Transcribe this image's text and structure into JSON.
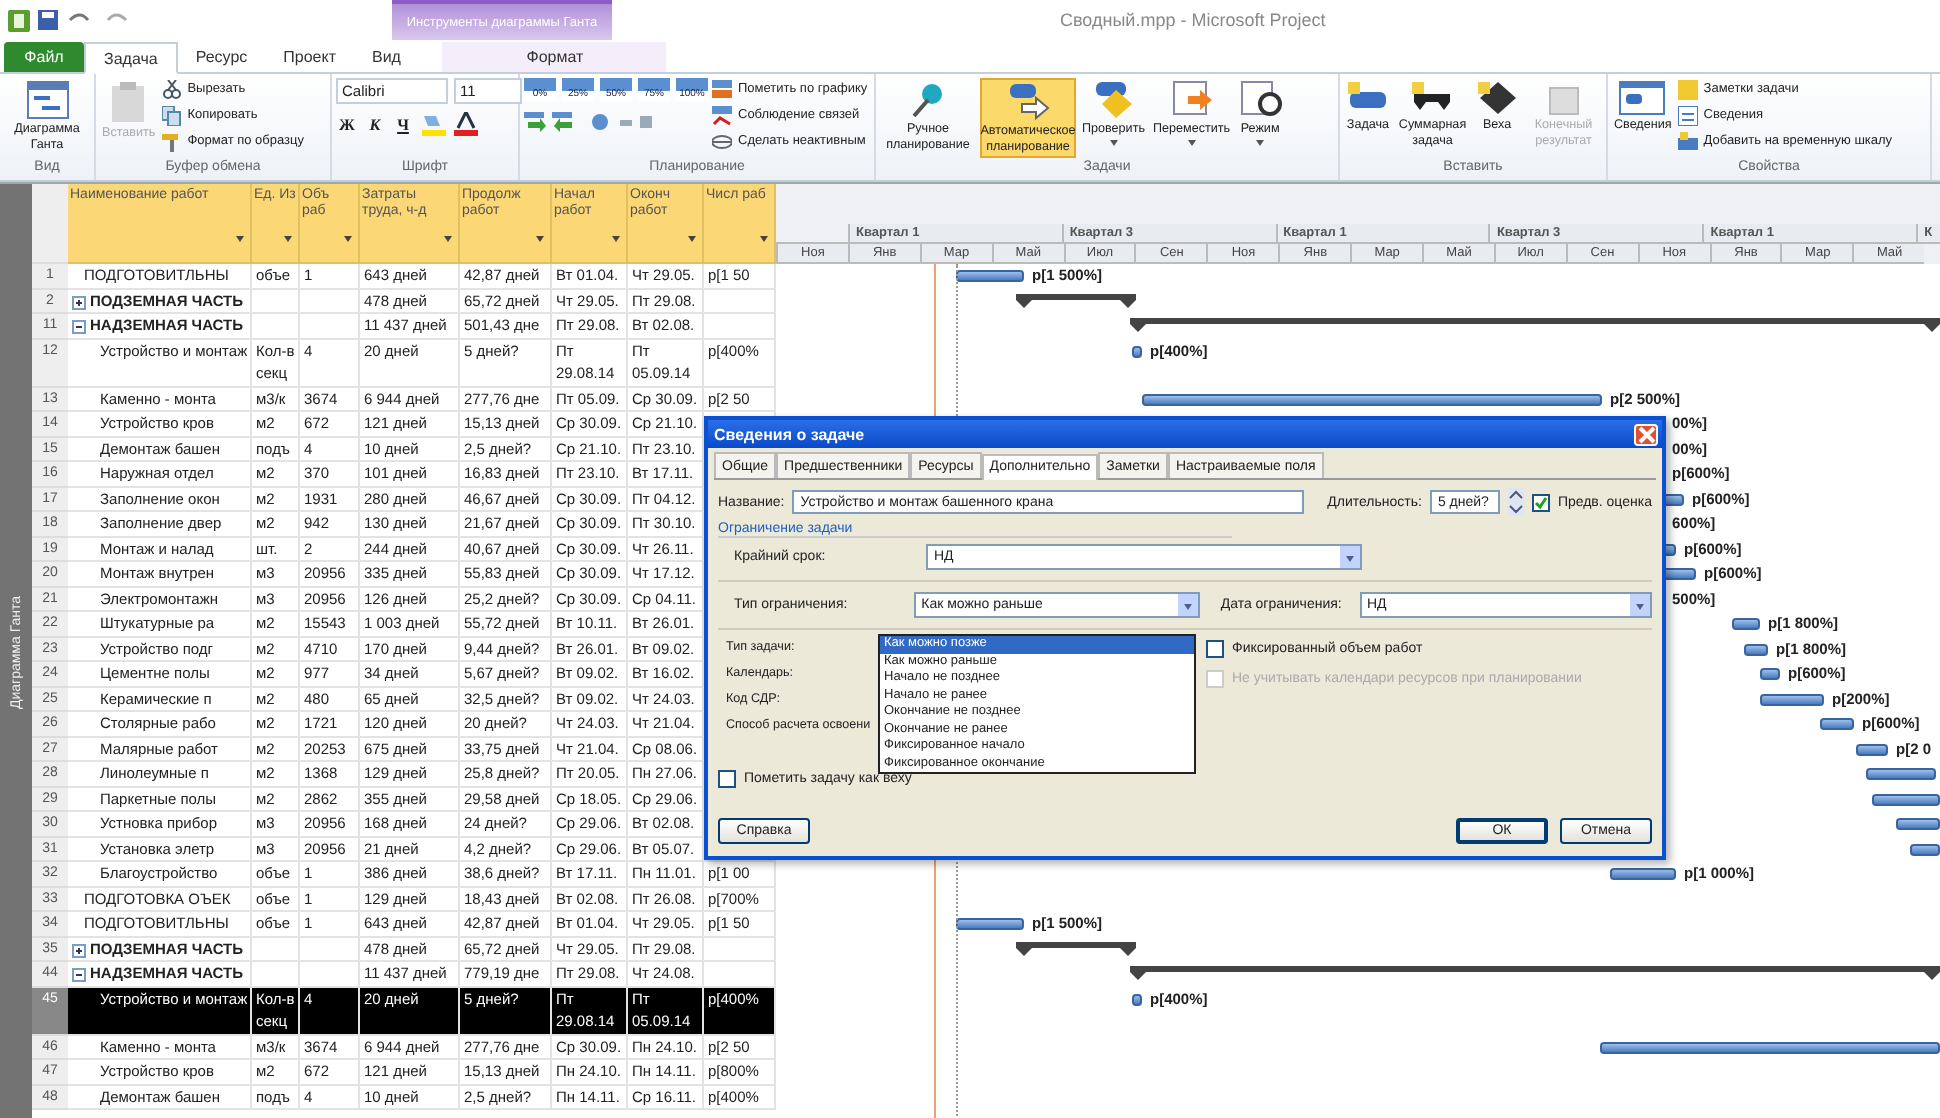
{
  "window": {
    "title": "Сводный.mpp - Microsoft Project",
    "contextual_group": "Инструменты диаграммы Ганта"
  },
  "ribbon_tabs": [
    {
      "label": "Файл",
      "kind": "file",
      "selected": false
    },
    {
      "label": "Задача",
      "kind": "normal",
      "selected": true
    },
    {
      "label": "Ресурс",
      "kind": "normal",
      "selected": false
    },
    {
      "label": "Проект",
      "kind": "normal",
      "selected": false
    },
    {
      "label": "Вид",
      "kind": "normal",
      "selected": false
    },
    {
      "label": "Формат",
      "kind": "contextual",
      "selected": false
    }
  ],
  "ribbon": {
    "view": {
      "label": "Вид",
      "gantt_button": "Диаграмма Ганта"
    },
    "clipboard": {
      "label": "Буфер обмена",
      "paste": {
        "label": "Вставить",
        "disabled": true
      },
      "commands": [
        "Вырезать",
        "Копировать",
        "Формат по образцу"
      ]
    },
    "font": {
      "label": "Шрифт",
      "family": "Calibri",
      "size": "11",
      "styles": [
        "Ж",
        "К",
        "Ч"
      ]
    },
    "schedule": {
      "label": "Планирование",
      "percents": [
        "0%",
        "25%",
        "50%",
        "75%",
        "100%"
      ],
      "commands": [
        "Пометить по графику",
        "Соблюдение связей",
        "Сделать неактивным"
      ]
    },
    "tasks": {
      "label": "Задачи",
      "buttons": [
        {
          "label": "Ручное планирование",
          "selected": false
        },
        {
          "label": "Автоматическое планирование",
          "selected": true
        },
        {
          "label": "Проверить",
          "selected": false
        },
        {
          "label": "Переместить",
          "selected": false
        },
        {
          "label": "Режим",
          "selected": false
        }
      ]
    },
    "insert": {
      "label": "Вставить",
      "buttons": [
        {
          "label": "Задача",
          "disabled": false
        },
        {
          "label": "Суммарная задача",
          "disabled": false
        },
        {
          "label": "Веха",
          "disabled": false
        },
        {
          "label": "Конечный результат",
          "disabled": true
        }
      ]
    },
    "properties": {
      "label": "Свойства",
      "big_button": "Сведения",
      "commands": [
        "Заметки задачи",
        "Сведения",
        "Добавить на временную шкалу"
      ]
    }
  },
  "side_label": "Диаграмма Ганта",
  "table": {
    "columns": [
      "Наименование работ",
      "Ед. Из",
      "Объ раб",
      "Затраты труда, ч-д",
      "Продолж работ",
      "Начал работ",
      "Оконч работ",
      "Числ раб"
    ],
    "rows": [
      {
        "id": "1",
        "name": "ПОДГОТОВИТЛЬНЫ",
        "unit": "объе",
        "volume": "1",
        "labor": "643 дней",
        "duration": "42,87 дней",
        "start": "Вт 01.04.",
        "finish": "Чт 29.05.",
        "resource": "р[1 50",
        "selected": false,
        "bar": {
          "kind": "task",
          "label": "р[1 500%]"
        }
      },
      {
        "id": "2",
        "name": "ПОДЗЕМНАЯ ЧАСТЬ",
        "labor": "478 дней",
        "duration": "65,72 дней",
        "start": "Чт 29.05.",
        "finish": "Пт 29.08.",
        "selected": false,
        "expanded": false,
        "bar": {
          "kind": "summary"
        }
      },
      {
        "id": "11",
        "name": "НАДЗЕМНАЯ ЧАСТЬ",
        "labor": "11 437 дней",
        "duration": "501,43 дне",
        "start": "Пт 29.08.",
        "finish": "Вт 02.08.",
        "selected": false,
        "expanded": true,
        "bar": {
          "kind": "summary"
        },
        "children": [
          {
            "id": "12",
            "name": "Устройство и монтаж",
            "unit": "Кол-в секц",
            "volume": "4",
            "labor": "20 дней",
            "duration": "5 дней?",
            "start": "Пт 29.08.14",
            "finish": "Пт 05.09.14",
            "resource": "р[400%",
            "selected": false,
            "bar": {
              "kind": "task",
              "label": "р[400%]"
            }
          },
          {
            "id": "13",
            "name": "Каменно - монта",
            "unit": "м3/к",
            "volume": "3674",
            "labor": "6 944 дней",
            "duration": "277,76 дне",
            "start": "Пт 05.09.",
            "finish": "Ср 30.09.",
            "resource": "р[2 50",
            "selected": false,
            "bar": {
              "kind": "task",
              "label": "р[2 500%]"
            }
          },
          {
            "id": "14",
            "name": "Устройство кров",
            "unit": "м2",
            "volume": "672",
            "labor": "121 дней",
            "duration": "15,13 дней",
            "start": "Ср 30.09.",
            "finish": "Ср 21.10.",
            "selected": false,
            "bar": {
              "kind": "label",
              "label": "00%]"
            }
          },
          {
            "id": "15",
            "name": "Демонтаж башен",
            "unit": "подъ",
            "volume": "4",
            "labor": "10 дней",
            "duration": "2,5 дней?",
            "start": "Ср 21.10.",
            "finish": "Пт 23.10.",
            "selected": false,
            "bar": {
              "kind": "label",
              "label": "00%]"
            }
          },
          {
            "id": "16",
            "name": "Наружная отдел",
            "unit": "м2",
            "volume": "370",
            "labor": "101 дней",
            "duration": "16,83 дней",
            "start": "Пт 23.10.",
            "finish": "Вт 17.11.",
            "selected": false,
            "bar": {
              "kind": "label",
              "label": "р[600%]"
            }
          },
          {
            "id": "17",
            "name": "Заполнение окон",
            "unit": "м2",
            "volume": "1931",
            "labor": "280 дней",
            "duration": "46,67 дней",
            "start": "Ср 30.09.",
            "finish": "Пт 04.12.",
            "selected": false,
            "bar": {
              "kind": "task",
              "label": "р[600%]"
            }
          },
          {
            "id": "18",
            "name": "Заполнение двер",
            "unit": "м2",
            "volume": "942",
            "labor": "130 дней",
            "duration": "21,67 дней",
            "start": "Ср 30.09.",
            "finish": "Пт 30.10.",
            "selected": false,
            "bar": {
              "kind": "label",
              "label": "600%]"
            }
          },
          {
            "id": "19",
            "name": "Монтаж и налад",
            "unit": "шт.",
            "volume": "2",
            "labor": "244 дней",
            "duration": "40,67 дней",
            "start": "Ср 30.09.",
            "finish": "Чт 26.11.",
            "selected": false,
            "bar": {
              "kind": "task",
              "label": "р[600%]"
            }
          },
          {
            "id": "20",
            "name": "Монтаж внутрен",
            "unit": "м3",
            "volume": "20956",
            "labor": "335 дней",
            "duration": "55,83 дней",
            "start": "Ср 30.09.",
            "finish": "Чт 17.12.",
            "selected": false,
            "bar": {
              "kind": "task",
              "label": "р[600%]"
            }
          },
          {
            "id": "21",
            "name": "Электромонтажн",
            "unit": "м3",
            "volume": "20956",
            "labor": "126 дней",
            "duration": "25,2 дней?",
            "start": "Ср 30.09.",
            "finish": "Ср 04.11.",
            "selected": false,
            "bar": {
              "kind": "label",
              "label": "500%]"
            }
          },
          {
            "id": "22",
            "name": "Штукатурные ра",
            "unit": "м2",
            "volume": "15543",
            "labor": "1 003 дней",
            "duration": "55,72 дней",
            "start": "Вт 10.11.",
            "finish": "Вт 26.01.",
            "selected": false,
            "bar": {
              "kind": "task",
              "label": "р[1 800%]"
            }
          },
          {
            "id": "23",
            "name": "Устройство подг",
            "unit": "м2",
            "volume": "4710",
            "labor": "170 дней",
            "duration": "9,44 дней?",
            "start": "Вт 26.01.",
            "finish": "Вт 09.02.",
            "selected": false,
            "bar": {
              "kind": "task",
              "label": "р[1 800%]"
            }
          },
          {
            "id": "24",
            "name": "Цементне полы",
            "unit": "м2",
            "volume": "977",
            "labor": "34 дней",
            "duration": "5,67 дней?",
            "start": "Вт 09.02.",
            "finish": "Вт 16.02.",
            "selected": false,
            "bar": {
              "kind": "task",
              "label": "р[600%]"
            }
          },
          {
            "id": "25",
            "name": "Керамические п",
            "unit": "м2",
            "volume": "480",
            "labor": "65 дней",
            "duration": "32,5 дней?",
            "start": "Вт 09.02.",
            "finish": "Чт 24.03.",
            "selected": false,
            "bar": {
              "kind": "task",
              "label": "р[200%]"
            }
          },
          {
            "id": "26",
            "name": "Столярные рабо",
            "unit": "м2",
            "volume": "1721",
            "labor": "120 дней",
            "duration": "20 дней?",
            "start": "Чт 24.03.",
            "finish": "Чт 21.04.",
            "selected": false,
            "bar": {
              "kind": "task",
              "label": "р[600%]"
            }
          },
          {
            "id": "27",
            "name": "Малярные работ",
            "unit": "м2",
            "volume": "20253",
            "labor": "675 дней",
            "duration": "33,75 дней",
            "start": "Чт 21.04.",
            "finish": "Ср 08.06.",
            "selected": false,
            "bar": {
              "kind": "task",
              "label": "р[2 0"
            }
          },
          {
            "id": "28",
            "name": "Линолеумные п",
            "unit": "м2",
            "volume": "1368",
            "labor": "129 дней",
            "duration": "25,8 дней?",
            "start": "Пт 20.05.",
            "finish": "Пн 27.06.",
            "selected": false,
            "bar": {
              "kind": "task"
            }
          },
          {
            "id": "29",
            "name": "Паркетные полы",
            "unit": "м2",
            "volume": "2862",
            "labor": "355 дней",
            "duration": "29,58 дней",
            "start": "Ср 18.05.",
            "finish": "Ср 29.06.",
            "selected": false,
            "bar": {
              "kind": "task"
            }
          },
          {
            "id": "30",
            "name": "Устновка прибор",
            "unit": "м3",
            "volume": "20956",
            "labor": "168 дней",
            "duration": "24 дней?",
            "start": "Ср 29.06.",
            "finish": "Вт 02.08.",
            "selected": false,
            "bar": {
              "kind": "task"
            }
          },
          {
            "id": "31",
            "name": "Установка элетр",
            "unit": "м3",
            "volume": "20956",
            "labor": "21 дней",
            "duration": "4,2 дней?",
            "start": "Ср 29.06.",
            "finish": "Вт 05.07.",
            "selected": false,
            "bar": {
              "kind": "task"
            }
          },
          {
            "id": "32",
            "name": "Благоустройство",
            "unit": "объе",
            "volume": "1",
            "labor": "386 дней",
            "duration": "38,6 дней?",
            "start": "Вт 17.11.",
            "finish": "Пн 11.01.",
            "resource": "р[1 00",
            "selected": false,
            "bar": {
              "kind": "task",
              "label": "р[1 000%]"
            }
          }
        ]
      },
      {
        "id": "33",
        "name": "ПОДГОТОВКА ОЪЕК",
        "unit": "объе",
        "volume": "1",
        "labor": "129 дней",
        "duration": "18,43 дней",
        "start": "Вт 02.08.",
        "finish": "Пт 26.08.",
        "resource": "р[700%",
        "selected": false
      },
      {
        "id": "34",
        "name": "ПОДГОТОВИТЛЬНЫ",
        "unit": "объе",
        "volume": "1",
        "labor": "643 дней",
        "duration": "42,87 дней",
        "start": "Вт 01.04.",
        "finish": "Чт 29.05.",
        "resource": "р[1 50",
        "selected": false,
        "bar": {
          "kind": "task",
          "label": "р[1 500%]"
        }
      },
      {
        "id": "35",
        "name": "ПОДЗЕМНАЯ ЧАСТЬ",
        "labor": "478 дней",
        "duration": "65,72 дней",
        "start": "Чт 29.05.",
        "finish": "Пт 29.08.",
        "selected": false,
        "expanded": false,
        "bar": {
          "kind": "summary"
        }
      },
      {
        "id": "44",
        "name": "НАДЗЕМНАЯ ЧАСТЬ",
        "labor": "11 437 дней",
        "duration": "779,19 дне",
        "start": "Пт 29.08.",
        "finish": "Чт 24.08.",
        "selected": false,
        "expanded": true,
        "bar": {
          "kind": "summary"
        },
        "children": [
          {
            "id": "45",
            "name": "Устройство и монтаж",
            "unit": "Кол-в секц",
            "volume": "4",
            "labor": "20 дней",
            "duration": "5 дней?",
            "start": "Пт 29.08.14",
            "finish": "Пт 05.09.14",
            "resource": "р[400%",
            "selected": true,
            "bar": {
              "kind": "task",
              "label": "р[400%]"
            }
          },
          {
            "id": "46",
            "name": "Каменно - монта",
            "unit": "м3/к",
            "volume": "3674",
            "labor": "6 944 дней",
            "duration": "277,76 дне",
            "start": "Ср 30.09.",
            "finish": "Пн 24.10.",
            "resource": "р[2 50",
            "selected": false,
            "bar": {
              "kind": "task"
            }
          },
          {
            "id": "47",
            "name": "Устройство кров",
            "unit": "м2",
            "volume": "672",
            "labor": "121 дней",
            "duration": "15,13 дней",
            "start": "Пн 24.10.",
            "finish": "Пн 14.11.",
            "resource": "р[800%",
            "selected": false
          },
          {
            "id": "48",
            "name": "Демонтаж башен",
            "unit": "подъ",
            "volume": "4",
            "labor": "10 дней",
            "duration": "2,5 дней?",
            "start": "Пн 14.11.",
            "finish": "Ср 16.11.",
            "resource": "р[400%",
            "selected": false
          }
        ]
      }
    ]
  },
  "timescale": {
    "quarters": [
      "Квартал 1",
      "Квартал 3",
      "Квартал 1",
      "Квартал 3",
      "Квартал 1",
      "К"
    ],
    "months": [
      "Ноя",
      "Янв",
      "Мар",
      "Май",
      "Июл",
      "Сен",
      "Ноя",
      "Янв",
      "Мар",
      "Май",
      "Июл",
      "Сен",
      "Ноя",
      "Янв",
      "Мар",
      "Май"
    ]
  },
  "dialog": {
    "title": "Сведения о задаче",
    "tabs": [
      {
        "label": "Общие",
        "selected": false
      },
      {
        "label": "Предшественники",
        "selected": false
      },
      {
        "label": "Ресурсы",
        "selected": false
      },
      {
        "label": "Дополнительно",
        "selected": true
      },
      {
        "label": "Заметки",
        "selected": false
      },
      {
        "label": "Настраиваемые поля",
        "selected": false
      }
    ],
    "name_label": "Название:",
    "name_value": "Устройство и монтаж башенного крана",
    "duration_label": "Длительность:",
    "duration_value": "5 дней?",
    "estimate": {
      "label": "Предв. оценка",
      "checked": true
    },
    "section": "Ограничение задачи",
    "deadline_label": "Крайний срок:",
    "deadline_value": "НД",
    "constraint_label": "Тип ограничения:",
    "constraint_value": "Как можно раньше",
    "constraint_date_label": "Дата ограничения:",
    "constraint_date_value": "НД",
    "constraint_options": [
      {
        "label": "Как можно позже",
        "selected": true
      },
      {
        "label": "Как можно раньше",
        "selected": false
      },
      {
        "label": "Начало не позднее",
        "selected": false
      },
      {
        "label": "Начало не ранее",
        "selected": false
      },
      {
        "label": "Окончание не позднее",
        "selected": false
      },
      {
        "label": "Окончание не ранее",
        "selected": false
      },
      {
        "label": "Фиксированное начало",
        "selected": false
      },
      {
        "label": "Фиксированное окончание",
        "selected": false
      }
    ],
    "labels": [
      "Тип задачи:",
      "Календарь:",
      "Код СДР:",
      "Способ расчета освоени"
    ],
    "fixed_work": {
      "label": "Фиксированный объем работ",
      "checked": false,
      "disabled": false
    },
    "ignore_calendars": {
      "label": "Не учитывать календари ресурсов при планировании",
      "checked": false,
      "disabled": true
    },
    "milestone": {
      "label": "Пометить задачу как веху",
      "checked": false
    },
    "buttons": [
      "Справка",
      "ОК",
      "Отмена"
    ]
  }
}
